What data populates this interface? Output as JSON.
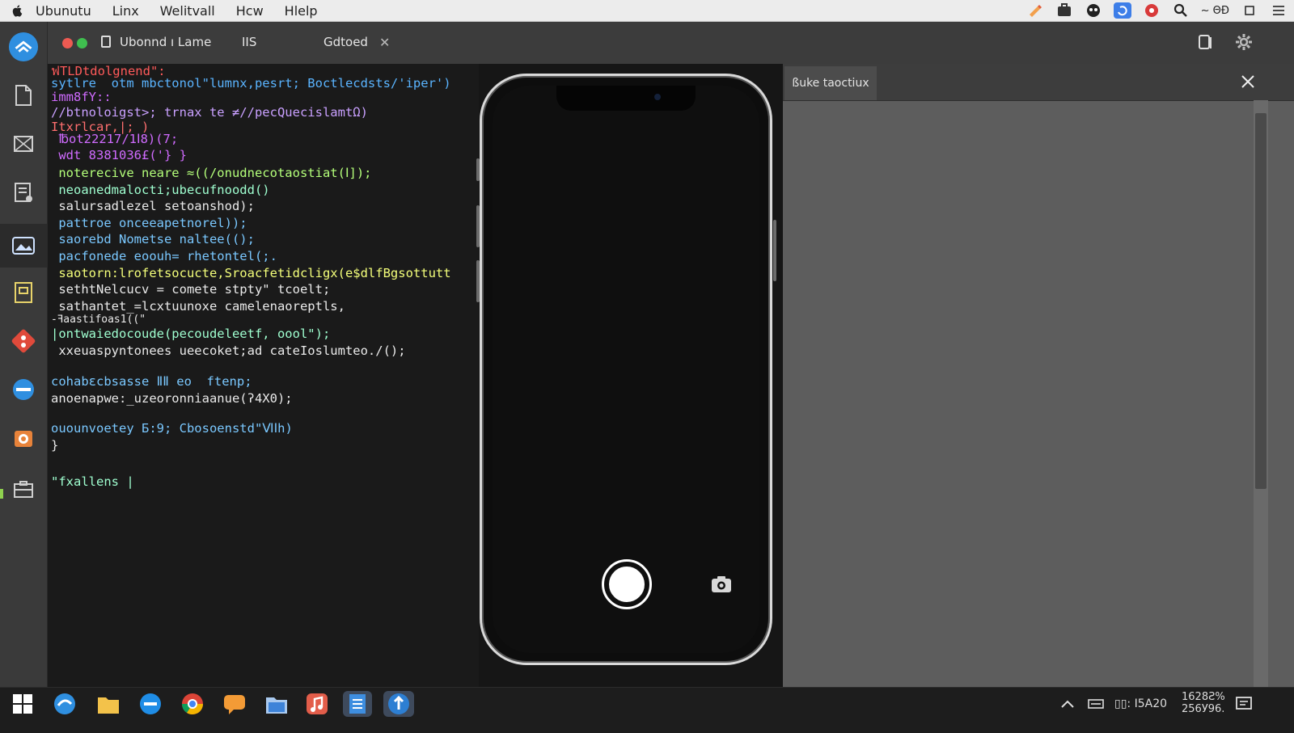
{
  "menubar": {
    "items": [
      "Ubunutu",
      "Linx",
      "Welitvall",
      "Hcw",
      "Hlelp"
    ],
    "clock": "~ ΘĐ"
  },
  "tabs": {
    "tab1": "Ubonnd ı Lame",
    "tab2": "IIS",
    "tab3": "Gdtoed"
  },
  "code": {
    "lines": [
      {
        "text": "ฟTLDtdolgnend\":",
        "color": "#ff5a5a"
      },
      {
        "text": "sytlre  otm mbctonol\"lumnx,pesrt; Boctlecdsts/'iper')",
        "color": "#5ab4ff"
      },
      {
        "text": "imm8fY::",
        "color": "#d06bff"
      },
      {
        "text": "//btnoloigst>; trnax te ≠//pecQuecislamtΩ)",
        "color": "#c9a0ff"
      },
      {
        "text": "Itxrlcar,|; )",
        "color": "#ff6f6f"
      },
      {
        "text": " ℔ot22217/1Ⅰ8)(7;",
        "color": "#d06bff"
      },
      {
        "text": " wdt 8381036£('} }",
        "color": "#d06bff"
      },
      {
        "text": " noterecive neare ≈((/onudnecotaostiat(Ⅰ]);",
        "color": "#b4ff7a"
      },
      {
        "text": " neoanedmalocti;ubecufnoodd()",
        "color": "#9fffd0"
      },
      {
        "text": " salursadlezel setoanshod);",
        "color": "#eaeaea"
      },
      {
        "text": " pattroe onceeapetnorel));",
        "color": "#7ac8ff"
      },
      {
        "text": " saorebd Nometse naltee(();",
        "color": "#7ac8ff"
      },
      {
        "text": " pacfonede eoouh= rhetontel(;.",
        "color": "#7ac8ff"
      },
      {
        "text": " saotorn:lrofetsocucte,Sroacfetidcligx(e$dlfBgsottutt",
        "color": "#f4ff7a"
      },
      {
        "text": " sethtNelcucv = comete stpty\" tcoelt;",
        "color": "#eaeaea"
      },
      {
        "text": " sathantet_=lcxtuunoxe camelenaoreptls,",
        "color": "#eaeaea"
      },
      {
        "text": "-ꟻaastifoas1((\"",
        "color": "#eaeaea"
      },
      {
        "text": "|ontwaiedocoude(pecoudeleetf, oool\");",
        "color": "#9fffd0"
      },
      {
        "text": " xxeuaspyntonees ueecoket;ad cateIoslumteo./();",
        "color": "#eaeaea"
      },
      {
        "text": "cohabεcbsasse ⅡⅡ eo  ftenp;",
        "color": "#7ac8ff"
      },
      {
        "text": "anoenapwe:_uzeoronniaanue(ʔ4X0);",
        "color": "#eaeaea"
      },
      {
        "text": "ouounvoetey Ƃ:9; Cbosoenstd\"ⅥⅠh)",
        "color": "#7ac8ff"
      },
      {
        "text": "}",
        "color": "#eaeaea"
      },
      {
        "text": "\"fxallens |",
        "color": "#9fffd0"
      }
    ]
  },
  "panel": {
    "tab_label": "ßuke taoctiux"
  },
  "taskbar": {
    "tray_text": "▯▯: Ⅰ5A20",
    "clock_line1": "1628Ƨ%",
    "clock_line2": "256У96."
  },
  "colors": {
    "accent_blue": "#2f8fe0",
    "traffic_red": "#ee5a52",
    "traffic_green": "#3fbf4f"
  },
  "icons": {
    "dock": [
      "app-launcher-icon",
      "document-icon",
      "network-icon",
      "notes-icon",
      "image-viewer-icon",
      "archive-icon",
      "git-icon",
      "browser-icon",
      "package-icon",
      "terminal-icon"
    ],
    "taskbar": [
      "start-icon",
      "edge-icon",
      "files-icon",
      "ie-icon",
      "chrome-icon",
      "chat-icon",
      "folder-icon",
      "music-icon",
      "document-icon",
      "vscode-icon"
    ]
  }
}
